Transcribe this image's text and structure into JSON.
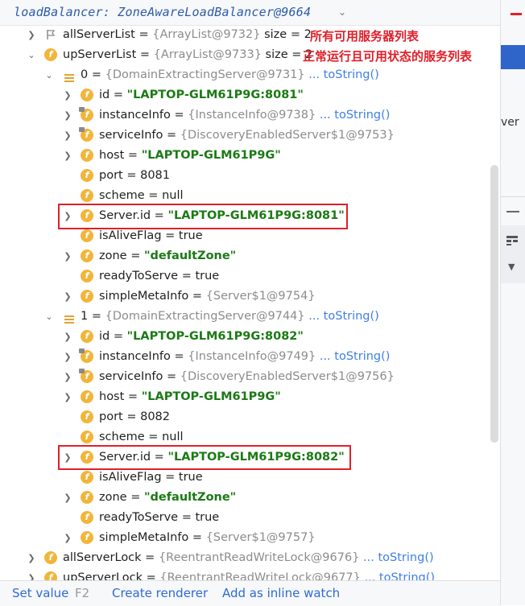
{
  "header": {
    "expression": "loadBalancer: ZoneAwareLoadBalancer@9664"
  },
  "annotations": {
    "all_servers": "所有可用服务器列表",
    "up_servers": "正常运行且可用状态的服务列表"
  },
  "rows": [
    {
      "name": "allServerList",
      "eq": " = ",
      "type": "{ArrayList@9732}",
      "suffix": "  size = 2"
    },
    {
      "name": "upServerList",
      "eq": " = ",
      "type": "{ArrayList@9733}",
      "suffix": "  size = 2"
    },
    {
      "name": "0",
      "eq": " = ",
      "type": "{DomainExtractingServer@9731}",
      "link": " ... toString()"
    },
    {
      "name": "id",
      "eq": " = ",
      "str": "\"LAPTOP-GLM61P9G:8081\""
    },
    {
      "name": "instanceInfo",
      "eq": " = ",
      "type": "{InstanceInfo@9738}",
      "link": " ... toString()"
    },
    {
      "name": "serviceInfo",
      "eq": " = ",
      "type": "{DiscoveryEnabledServer$1@9753}"
    },
    {
      "name": "host",
      "eq": " = ",
      "str": "\"LAPTOP-GLM61P9G\""
    },
    {
      "name": "port",
      "eq": " = ",
      "val": "8081"
    },
    {
      "name": "scheme",
      "eq": " = ",
      "val": "null"
    },
    {
      "name": "Server.id",
      "eq": " = ",
      "str": "\"LAPTOP-GLM61P9G:8081\""
    },
    {
      "name": "isAliveFlag",
      "eq": " = ",
      "val": "true"
    },
    {
      "name": "zone",
      "eq": " = ",
      "str": "\"defaultZone\""
    },
    {
      "name": "readyToServe",
      "eq": " = ",
      "val": "true"
    },
    {
      "name": "simpleMetaInfo",
      "eq": " = ",
      "type": "{Server$1@9754}"
    },
    {
      "name": "1",
      "eq": " = ",
      "type": "{DomainExtractingServer@9744}",
      "link": " ... toString()"
    },
    {
      "name": "id",
      "eq": " = ",
      "str": "\"LAPTOP-GLM61P9G:8082\""
    },
    {
      "name": "instanceInfo",
      "eq": " = ",
      "type": "{InstanceInfo@9749}",
      "link": " ... toString()"
    },
    {
      "name": "serviceInfo",
      "eq": " = ",
      "type": "{DiscoveryEnabledServer$1@9756}"
    },
    {
      "name": "host",
      "eq": " = ",
      "str": "\"LAPTOP-GLM61P9G\""
    },
    {
      "name": "port",
      "eq": " = ",
      "val": "8082"
    },
    {
      "name": "scheme",
      "eq": " = ",
      "val": "null"
    },
    {
      "name": "Server.id",
      "eq": " = ",
      "str": "\"LAPTOP-GLM61P9G:8082\""
    },
    {
      "name": "isAliveFlag",
      "eq": " = ",
      "val": "true"
    },
    {
      "name": "zone",
      "eq": " = ",
      "str": "\"defaultZone\""
    },
    {
      "name": "readyToServe",
      "eq": " = ",
      "val": "true"
    },
    {
      "name": "simpleMetaInfo",
      "eq": " = ",
      "type": "{Server$1@9757}"
    },
    {
      "name": "allServerLock",
      "eq": " = ",
      "type": "{ReentrantReadWriteLock@9676}",
      "link": " ... toString()"
    },
    {
      "name": "upServerLock",
      "eq": " = ",
      "type": "{ReentrantReadWriteLock@9677}",
      "link": " ... toString()"
    }
  ],
  "right_panel": {
    "text": "ver"
  },
  "bottom": {
    "set_value": "Set value",
    "shortcut": "F2",
    "create_renderer": "Create renderer",
    "add_inline_watch": "Add as inline watch"
  }
}
